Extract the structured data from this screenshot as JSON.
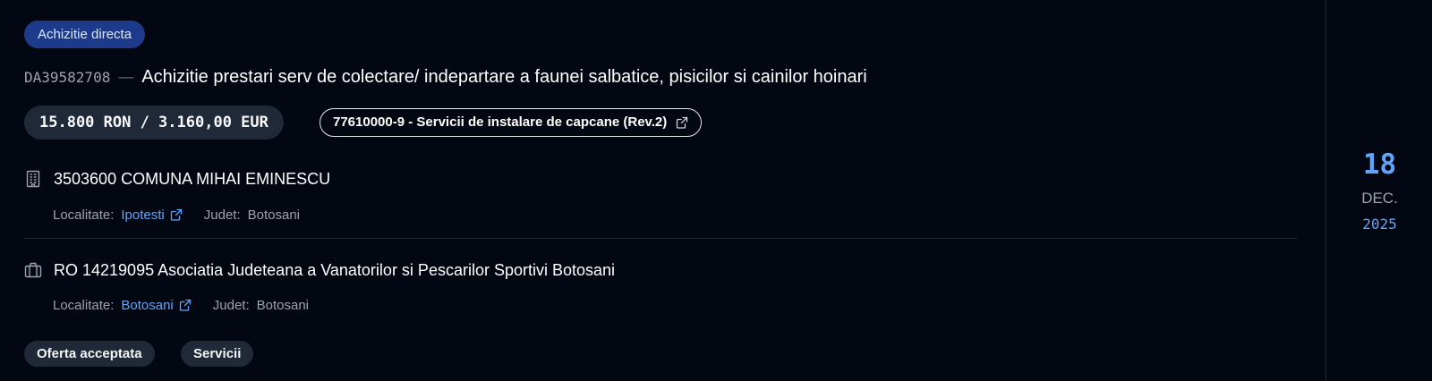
{
  "procedure": {
    "type_badge": "Achizitie directa",
    "ref_code": "DA39582708",
    "separator": "—",
    "title": "Achizitie prestari serv de colectare/ indepartare a faunei salbatice, pisicilor si cainilor hoinari",
    "price": "15.800 RON / 3.160,00 EUR",
    "cpv": "77610000-9 - Servicii de instalare de capcane (Rev.2)"
  },
  "authority": {
    "icon": "building-icon",
    "name": "3503600 COMUNA MIHAI EMINESCU",
    "locality_label": "Localitate:",
    "locality": "Ipotesti",
    "county_label": "Judet:",
    "county": "Botosani"
  },
  "supplier": {
    "icon": "briefcase-icon",
    "name": "RO 14219095 Asociatia Judeteana a Vanatorilor si Pescarilor Sportivi Botosani",
    "locality_label": "Localitate:",
    "locality": "Botosani",
    "county_label": "Judet:",
    "county": "Botosani"
  },
  "tags": [
    "Oferta acceptata",
    "Servicii"
  ],
  "date": {
    "day": "18",
    "month": "DEC.",
    "year": "2025"
  },
  "colors": {
    "background": "#030712",
    "accent": "#60a5fa",
    "badge": "#1e3a8a",
    "pill": "#1f2937"
  }
}
